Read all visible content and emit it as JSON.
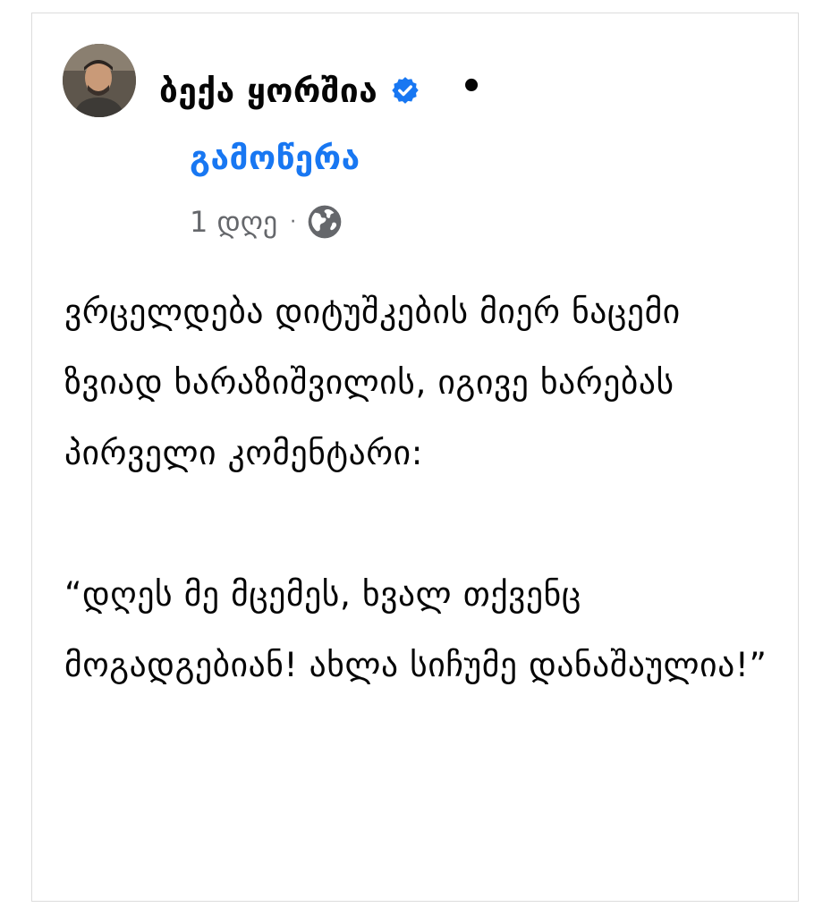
{
  "post": {
    "author": {
      "name": "ბექა ყორშია",
      "verified": true,
      "avatar_icon": "profile-photo"
    },
    "separator_dot": "•",
    "follow_label": "გამოწერა",
    "meta": {
      "time": "1 დღე",
      "separator": "·",
      "audience_icon": "globe-icon"
    },
    "body": {
      "paragraph_1": "ვრცელდება დიტუშკების მიერ ნაცემი ზვიად ხარაზიშვილის, იგივე ხარებას პირველი კომენტარი:",
      "paragraph_2": "“დღეს მე მცემეს, ხვალ თქვენც მოგადგებიან! ახლა სიჩუმე დანაშაულია!”"
    }
  },
  "colors": {
    "link": "#1877f2",
    "text": "#050505",
    "meta": "#65676b",
    "border": "#dcdcdc",
    "verified_badge": "#1877f2"
  }
}
